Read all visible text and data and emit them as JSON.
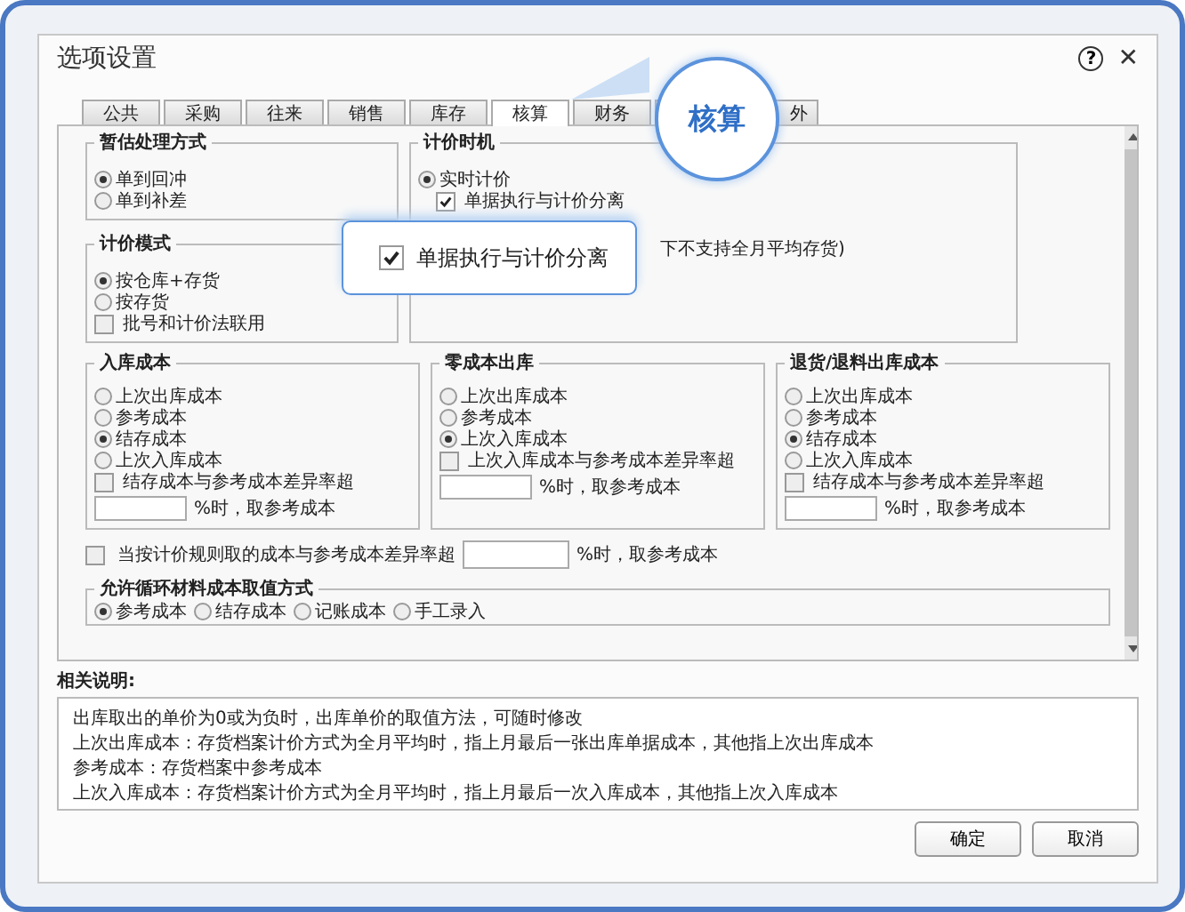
{
  "dialog": {
    "title": "选项设置",
    "help": "?",
    "close": "✕"
  },
  "tabs": [
    {
      "label": "公共",
      "selected": false
    },
    {
      "label": "采购",
      "selected": false
    },
    {
      "label": "往来",
      "selected": false
    },
    {
      "label": "销售",
      "selected": false
    },
    {
      "label": "库存",
      "selected": false
    },
    {
      "label": "核算",
      "selected": true
    },
    {
      "label": "财务",
      "selected": false
    },
    {
      "label": "外",
      "selected": false
    }
  ],
  "bubble": {
    "label": "核算"
  },
  "top_left": [
    {
      "title": "暂估处理方式",
      "items": [
        {
          "kind": "radio",
          "label": "单到回冲",
          "selected": true
        },
        {
          "kind": "radio",
          "label": "单到补差",
          "selected": false
        }
      ]
    },
    {
      "title": "计价模式",
      "items": [
        {
          "kind": "radio",
          "label": "按仓库+存货",
          "selected": true
        },
        {
          "kind": "radio",
          "label": "按存货",
          "selected": false
        },
        {
          "kind": "checkbox",
          "label": "批号和计价法联用",
          "checked": false
        }
      ]
    }
  ],
  "top_right": {
    "title": "计价时机",
    "items": [
      {
        "kind": "radio",
        "label": "实时计价",
        "selected": true
      },
      {
        "kind": "checkbox",
        "label": "单据执行与计价分离",
        "checked": true
      },
      {
        "kind": "text",
        "label": "下不支持全月平均存货)"
      }
    ]
  },
  "cost_groups": [
    {
      "title": "入库成本",
      "items": [
        {
          "kind": "radio",
          "label": "上次出库成本",
          "selected": false
        },
        {
          "kind": "radio",
          "label": "参考成本",
          "selected": false
        },
        {
          "kind": "radio",
          "label": "结存成本",
          "selected": true
        },
        {
          "kind": "radio",
          "label": "上次入库成本",
          "selected": false
        },
        {
          "kind": "checkbox",
          "label": "结存成本与参考成本差异率超",
          "checked": false
        },
        {
          "kind": "percent",
          "label": "%时，取参考成本"
        }
      ]
    },
    {
      "title": "零成本出库",
      "items": [
        {
          "kind": "radio",
          "label": "上次出库成本",
          "selected": false
        },
        {
          "kind": "radio",
          "label": "参考成本",
          "selected": false
        },
        {
          "kind": "radio",
          "label": "上次入库成本",
          "selected": true
        },
        {
          "kind": "checkbox",
          "label": "上次入库成本与参考成本差异率超",
          "checked": false
        },
        {
          "kind": "percent",
          "label": "%时，取参考成本"
        }
      ]
    },
    {
      "title": "退货/退料出库成本",
      "items": [
        {
          "kind": "radio",
          "label": "上次出库成本",
          "selected": false
        },
        {
          "kind": "radio",
          "label": "参考成本",
          "selected": false
        },
        {
          "kind": "radio",
          "label": "结存成本",
          "selected": true
        },
        {
          "kind": "radio",
          "label": "上次入库成本",
          "selected": false
        },
        {
          "kind": "checkbox",
          "label": "结存成本与参考成本差异率超",
          "checked": false
        },
        {
          "kind": "percent",
          "label": "%时，取参考成本"
        }
      ]
    }
  ],
  "diff_rule": {
    "label": "当按计价规则取的成本与参考成本差异率超",
    "checked": false,
    "suffix": "%时，取参考成本"
  },
  "loop_group": {
    "title": "允许循环材料成本取值方式",
    "options": [
      {
        "label": "参考成本",
        "selected": true
      },
      {
        "label": "结存成本",
        "selected": false
      },
      {
        "label": "记账成本",
        "selected": false
      },
      {
        "label": "手工录入",
        "selected": false
      }
    ]
  },
  "notes": {
    "title": "相关说明:",
    "lines": [
      "出库取出的单价为0或为负时，出库单价的取值方法，可随时修改",
      "上次出库成本：存货档案计价方式为全月平均时，指上月最后一张出库单据成本，其他指上次出库成本",
      "参考成本：存货档案中参考成本",
      "上次入库成本：存货档案计价方式为全月平均时，指上月最后一次入库成本，其他指上次入库成本"
    ]
  },
  "buttons": [
    "确定",
    "取消"
  ],
  "callout": {
    "label": "单据执行与计价分离",
    "checked": true
  }
}
